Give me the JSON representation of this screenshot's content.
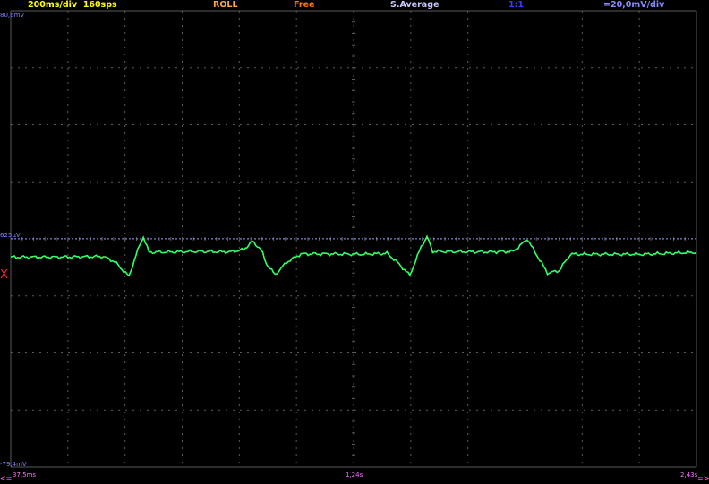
{
  "status_bar": {
    "timebase": "200ms/div  160sps",
    "mode": "ROLL",
    "trigger": "Free",
    "acquisition": "S.Average",
    "probe": "1:1",
    "vdiv": "=20,0mV/div"
  },
  "labels": {
    "top_voltage": "80,6mV",
    "trigger_level": "625µV",
    "bottom_voltage": "-79,4mV",
    "channel_marker": "X",
    "time_start": "37,5ms",
    "time_mid": "1,24s",
    "time_end": "2,43s",
    "scroll_left": "<=",
    "scroll_right": "=>"
  },
  "colors": {
    "timebase": "#ffff00",
    "mode": "#ffa64d",
    "trigger": "#ff7a1a",
    "acquisition": "#c8c8ff",
    "probe": "#3a3aff",
    "vdiv": "#8a8aff",
    "voltage_label": "#8080ff",
    "time_label": "#ff70ff",
    "trace": "#33ff66",
    "grid": "#5a5a5a",
    "trigger_line": "#9a9aff",
    "marker": "#ff2020"
  },
  "chart_data": {
    "type": "line",
    "x_range_s": [
      0.0375,
      2.43
    ],
    "y_range_mV": [
      -79.4,
      80.6
    ],
    "grid": true,
    "trigger_level_mV": 0.625,
    "series": [
      {
        "points": [
          [
            0.0375,
            -5.8
          ],
          [
            0.2,
            -5.8
          ],
          [
            0.36,
            -5.6
          ],
          [
            0.4,
            -7.4
          ],
          [
            0.45,
            -12.6
          ],
          [
            0.48,
            -3.5
          ],
          [
            0.5,
            1.3
          ],
          [
            0.52,
            -4.1
          ],
          [
            0.6,
            -4.0
          ],
          [
            0.7,
            -3.8
          ],
          [
            0.8,
            -4.0
          ],
          [
            0.85,
            -3.2
          ],
          [
            0.88,
            -0.3
          ],
          [
            0.91,
            -3.0
          ],
          [
            0.93,
            -8.2
          ],
          [
            0.96,
            -12.0
          ],
          [
            1.0,
            -7.6
          ],
          [
            1.05,
            -4.7
          ],
          [
            1.15,
            -4.7
          ],
          [
            1.27,
            -4.8
          ],
          [
            1.35,
            -4.5
          ],
          [
            1.38,
            -7.0
          ],
          [
            1.43,
            -12.2
          ],
          [
            1.47,
            -2.0
          ],
          [
            1.49,
            1.3
          ],
          [
            1.51,
            -3.8
          ],
          [
            1.6,
            -3.9
          ],
          [
            1.7,
            -4.0
          ],
          [
            1.79,
            -3.8
          ],
          [
            1.82,
            -1.3
          ],
          [
            1.84,
            0.6
          ],
          [
            1.86,
            -3.0
          ],
          [
            1.89,
            -7.9
          ],
          [
            1.91,
            -11.4
          ],
          [
            1.95,
            -10.6
          ],
          [
            1.99,
            -4.8
          ],
          [
            2.1,
            -4.8
          ],
          [
            2.25,
            -4.8
          ],
          [
            2.43,
            -4.1
          ]
        ]
      }
    ]
  }
}
